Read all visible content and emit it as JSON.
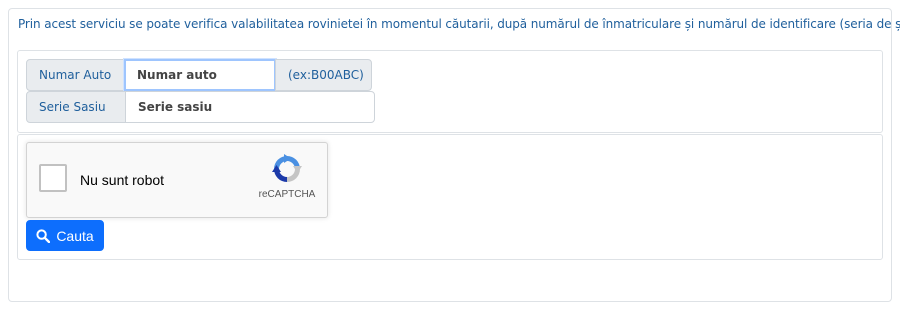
{
  "intro": {
    "text": "Prin acest serviciu se poate verifica valabilitatea rovinietei în momentul căutarii, după numărul de înmatriculare și numărul de identificare (seria de șasiu)."
  },
  "form": {
    "plate": {
      "label": "Numar Auto",
      "placeholder": "Numar auto",
      "value": "",
      "hint": "(ex:B00ABC)"
    },
    "vin": {
      "label": "Serie Sasiu",
      "placeholder": "Serie sasiu",
      "value": ""
    }
  },
  "captcha": {
    "label": "Nu sunt robot",
    "brand": "reCAPTCHA",
    "checked": false
  },
  "search_button": {
    "label": "Cauta",
    "icon": "search-icon"
  },
  "colors": {
    "primary": "#0d6efd",
    "text_blue": "#1f5f9c",
    "addon_bg": "#e9ecef",
    "border": "#dee2e6"
  }
}
